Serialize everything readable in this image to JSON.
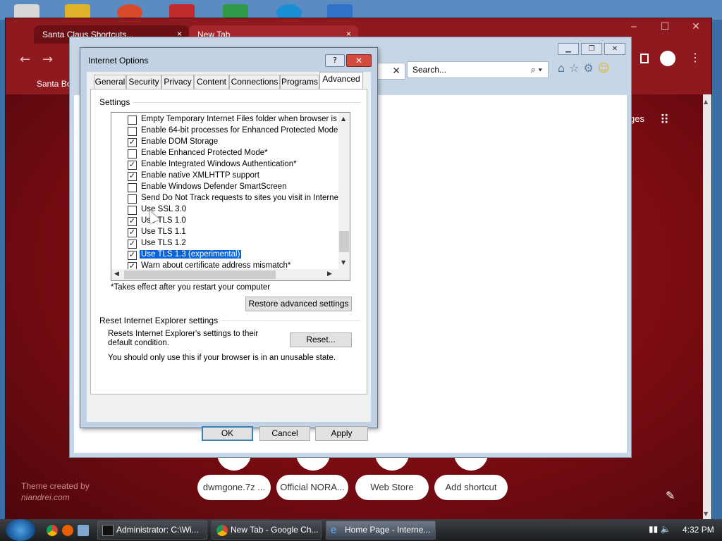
{
  "chrome": {
    "tab1_label": "Santa Claus Shortcuts...",
    "tab2_label": "New Tab",
    "tab_close": "×",
    "bookmark_label": "Santa Bo...",
    "images_label": "ges",
    "win_buttons": [
      "‒",
      "☐",
      "✕"
    ],
    "shortcuts": [
      "dwmgone.7z ...",
      "Official NORA...",
      "Web Store",
      "Add shortcut"
    ],
    "theme_credit_line1": "Theme created by",
    "theme_credit_line2": "niandrei.com"
  },
  "ie": {
    "search_placeholder": "Search...",
    "address_clear": "✕"
  },
  "dialog": {
    "title": "Internet Options",
    "help_label": "?",
    "close_label": "✕",
    "tabs": [
      "General",
      "Security",
      "Privacy",
      "Content",
      "Connections",
      "Programs",
      "Advanced"
    ],
    "active_tab": "Advanced",
    "settings_group": "Settings",
    "settings": [
      {
        "label": "Empty Temporary Internet Files folder when browser is clo",
        "checked": false
      },
      {
        "label": "Enable 64-bit processes for Enhanced Protected Mode*",
        "checked": false
      },
      {
        "label": "Enable DOM Storage",
        "checked": true
      },
      {
        "label": "Enable Enhanced Protected Mode*",
        "checked": false
      },
      {
        "label": "Enable Integrated Windows Authentication*",
        "checked": true
      },
      {
        "label": "Enable native XMLHTTP support",
        "checked": true
      },
      {
        "label": "Enable Windows Defender SmartScreen",
        "checked": false
      },
      {
        "label": "Send Do Not Track requests to sites you visit in Internet E",
        "checked": false
      },
      {
        "label": "Use SSL 3.0",
        "checked": false
      },
      {
        "label": "Use TLS 1.0",
        "checked": true
      },
      {
        "label": "Use TLS 1.1",
        "checked": true
      },
      {
        "label": "Use TLS 1.2",
        "checked": true
      },
      {
        "label": "Use TLS 1.3 (experimental)",
        "checked": true,
        "selected": true
      },
      {
        "label": "Warn about certificate address mismatch*",
        "checked": true
      }
    ],
    "restart_note": "*Takes effect after you restart your computer",
    "restore_button": "Restore advanced settings",
    "reset_group": "Reset Internet Explorer settings",
    "reset_desc": "Resets Internet Explorer's settings to their default condition.",
    "reset_button": "Reset...",
    "unusable_note": "You should only use this if your browser is in an unusable state.",
    "ok": "OK",
    "cancel": "Cancel",
    "apply": "Apply"
  },
  "taskbar": {
    "tasks": [
      "Administrator: C:\\Wi...",
      "New Tab - Google Ch...",
      "Home Page - Interne..."
    ],
    "clock": "4:32 PM"
  },
  "colors": {
    "selection": "#0a64d8",
    "chrome_theme": "#8e1a20",
    "dialog_frame": "#c2d2e4"
  }
}
